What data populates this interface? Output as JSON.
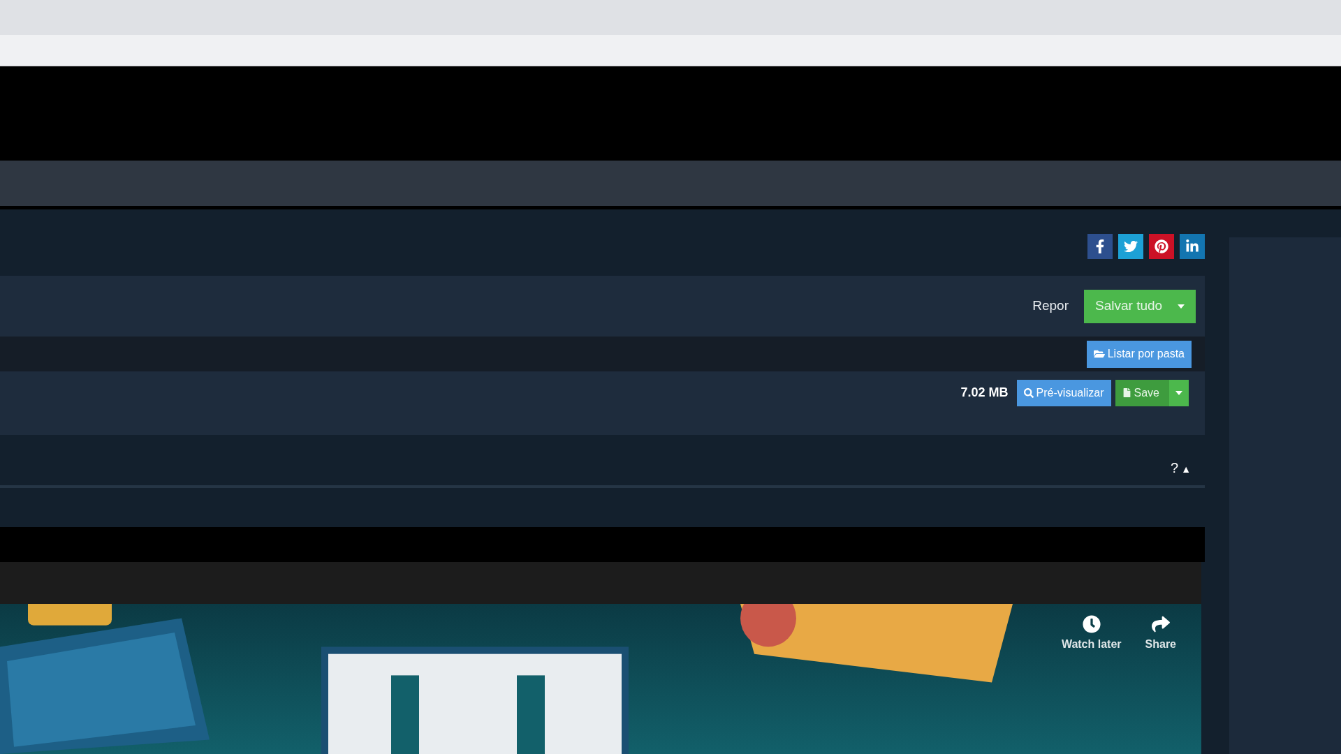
{
  "social_links": [
    {
      "kind": "facebook"
    },
    {
      "kind": "twitter"
    },
    {
      "kind": "pinterest"
    },
    {
      "kind": "linkedin"
    }
  ],
  "toolbar": {
    "reset": "Repor",
    "save_all": "Salvar tudo"
  },
  "folder_bar": {
    "list_by_folder": "Listar por pasta"
  },
  "file_row": {
    "size": "7.02 MB",
    "preview": "Pré-visualizar",
    "save": "Save"
  },
  "section": {
    "help": "?",
    "collapse": "▲"
  },
  "video": {
    "kind": "picture",
    "watch_later": "Watch later",
    "share": "Share"
  }
}
